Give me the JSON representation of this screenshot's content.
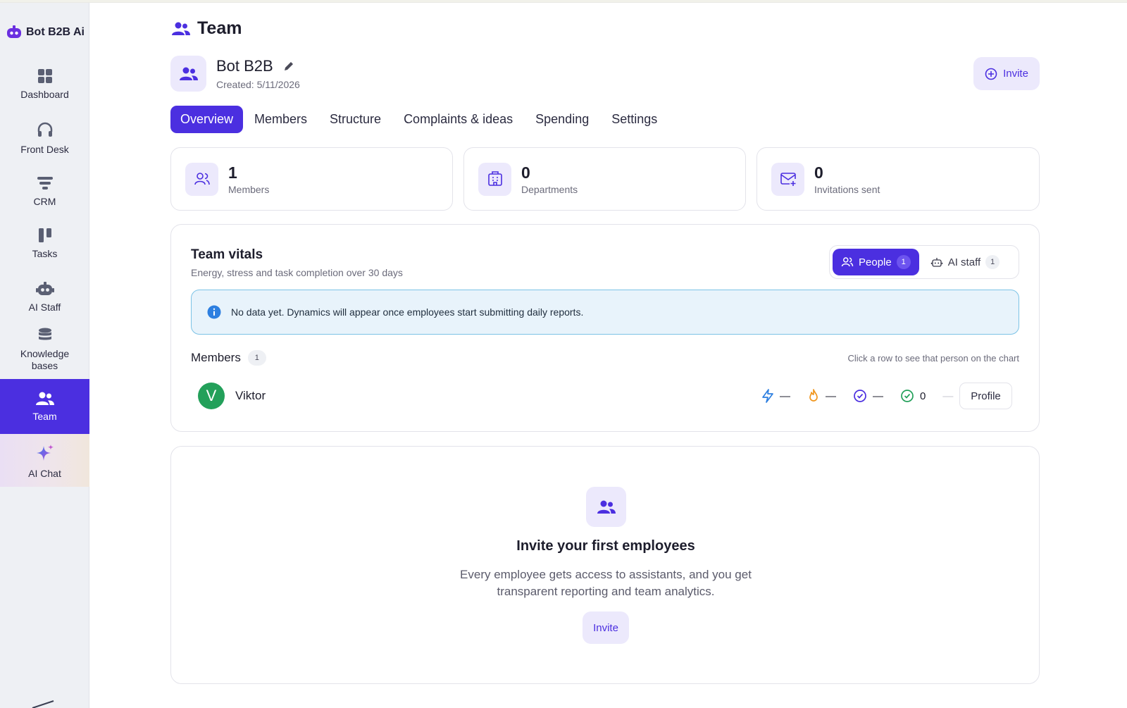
{
  "brand": {
    "name": "Bot B2B Ai",
    "icon": "robot-logo-icon",
    "color": "#6a2fe0"
  },
  "sidebar": {
    "items": [
      {
        "label": "Dashboard",
        "icon": "grid-icon"
      },
      {
        "label": "Front Desk",
        "icon": "headset-icon"
      },
      {
        "label": "CRM",
        "icon": "funnel-icon"
      },
      {
        "label": "Tasks",
        "icon": "kanban-icon"
      },
      {
        "label": "AI Staff",
        "icon": "robot-icon"
      },
      {
        "label": "Knowledge bases",
        "icon": "database-icon"
      },
      {
        "label": "Team",
        "icon": "users-icon",
        "active": true
      },
      {
        "label": "AI Chat",
        "icon": "sparkle-icon"
      }
    ]
  },
  "header": {
    "title": "Team"
  },
  "team": {
    "name": "Bot B2B",
    "created": "Created: 5/11/2026",
    "invite_label": "Invite"
  },
  "tabs": [
    {
      "label": "Overview",
      "active": true
    },
    {
      "label": "Members"
    },
    {
      "label": "Structure"
    },
    {
      "label": "Complaints & ideas"
    },
    {
      "label": "Spending"
    },
    {
      "label": "Settings"
    }
  ],
  "stats": [
    {
      "value": "1",
      "label": "Members",
      "icon": "users-outline-icon"
    },
    {
      "value": "0",
      "label": "Departments",
      "icon": "building-icon"
    },
    {
      "value": "0",
      "label": "Invitations sent",
      "icon": "mail-plus-icon"
    }
  ],
  "vitals": {
    "title": "Team vitals",
    "subtitle": "Energy, stress and task completion over 30 days",
    "toggle": {
      "people_label": "People",
      "people_count": "1",
      "ai_label": "AI staff",
      "ai_count": "1"
    },
    "info": "No data yet. Dynamics will appear once employees start submitting daily reports.",
    "members_title": "Members",
    "members_count": "1",
    "members_hint": "Click a row to see that person on the chart",
    "member": {
      "initial": "V",
      "name": "Viktor",
      "energy": "—",
      "stress": "—",
      "tasks": "—",
      "done": "0",
      "sep": "—",
      "profile_label": "Profile"
    }
  },
  "empty": {
    "title": "Invite your first employees",
    "description": "Every employee gets access to assistants, and you get transparent reporting and team analytics.",
    "button_label": "Invite"
  },
  "colors": {
    "accent": "#4b2fe0",
    "accent_soft": "#ece9fc",
    "info_bg": "#e8f3fb",
    "success": "#23a05a"
  }
}
